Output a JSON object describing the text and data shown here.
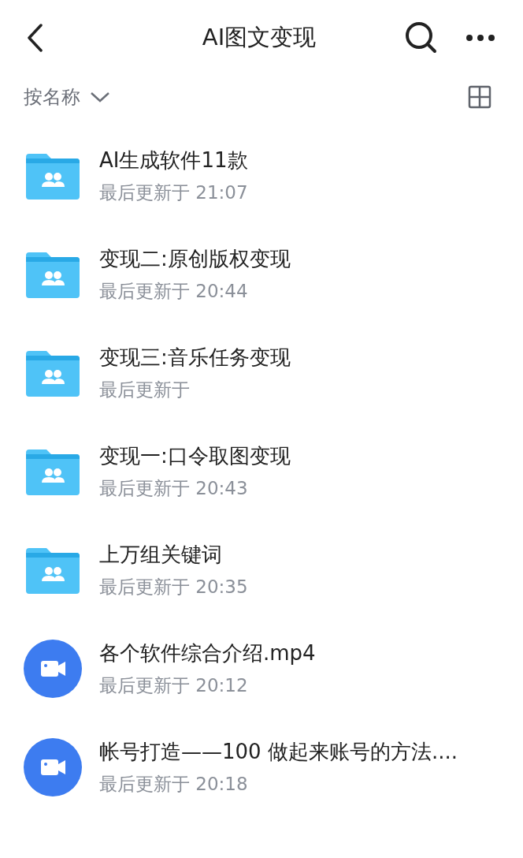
{
  "header": {
    "title": "AI图文变现"
  },
  "sort": {
    "label": "按名称"
  },
  "files": [
    {
      "kind": "folder",
      "name": "AI生成软件11款",
      "updated": "最后更新于 21:07"
    },
    {
      "kind": "folder",
      "name": "变现二:原创版权变现",
      "updated": "最后更新于 20:44"
    },
    {
      "kind": "folder",
      "name": "变现三:音乐任务变现",
      "updated": "最后更新于"
    },
    {
      "kind": "folder",
      "name": "变现一:口令取图变现",
      "updated": "最后更新于 20:43"
    },
    {
      "kind": "folder",
      "name": "上万组关键词",
      "updated": "最后更新于 20:35"
    },
    {
      "kind": "video",
      "name": "各个软件综合介绍.mp4",
      "updated": "最后更新于 20:12"
    },
    {
      "kind": "video",
      "name": "帐号打造——100 做起来账号的方法....",
      "updated": "最后更新于 20:18"
    }
  ]
}
